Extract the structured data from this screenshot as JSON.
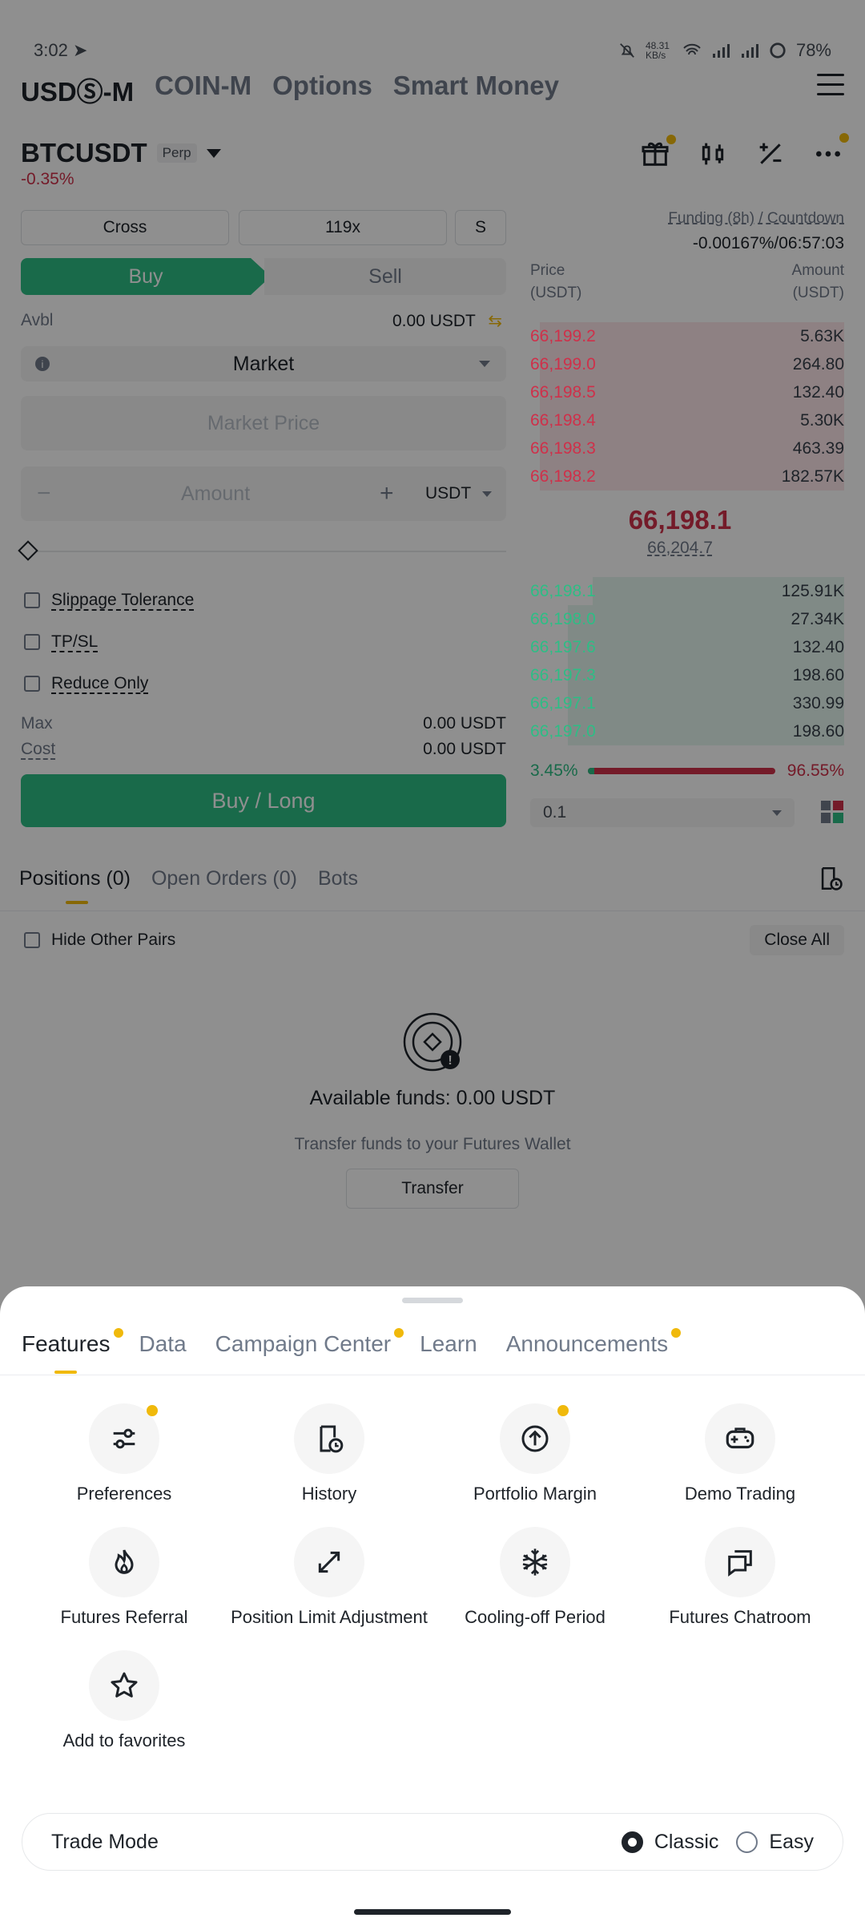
{
  "status_bar": {
    "time": "3:02",
    "net_speed": "48.31 KB/s",
    "battery": "78%"
  },
  "top_tabs": [
    "USDⓈ-M",
    "COIN-M",
    "Options",
    "Smart Money"
  ],
  "pair": {
    "symbol": "BTCUSDT",
    "tag": "Perp",
    "change": "-0.35%"
  },
  "order_form": {
    "margin_mode": "Cross",
    "leverage": "119x",
    "asset_mode": "S",
    "buy_label": "Buy",
    "sell_label": "Sell",
    "avbl_label": "Avbl",
    "avbl_value": "0.00 USDT",
    "order_type": "Market",
    "price_placeholder": "Market Price",
    "amount_placeholder": "Amount",
    "amount_unit": "USDT",
    "checkboxes": [
      "Slippage Tolerance",
      "TP/SL",
      "Reduce Only"
    ],
    "max_label": "Max",
    "max_value": "0.00 USDT",
    "cost_label": "Cost",
    "cost_value": "0.00 USDT",
    "submit_label": "Buy / Long"
  },
  "funding": {
    "label": "Funding (8h) / Countdown",
    "value": "-0.00167%/06:57:03"
  },
  "orderbook": {
    "price_header": "Price",
    "price_unit": "(USDT)",
    "amount_header": "Amount",
    "amount_unit": "(USDT)",
    "asks": [
      {
        "price": "66,199.2",
        "amount": "5.63K",
        "depth": 0.97
      },
      {
        "price": "66,199.0",
        "amount": "264.80",
        "depth": 0.97
      },
      {
        "price": "66,198.5",
        "amount": "132.40",
        "depth": 0.97
      },
      {
        "price": "66,198.4",
        "amount": "5.30K",
        "depth": 0.97
      },
      {
        "price": "66,198.3",
        "amount": "463.39",
        "depth": 0.97
      },
      {
        "price": "66,198.2",
        "amount": "182.57K",
        "depth": 0.97
      }
    ],
    "last_price": "66,198.1",
    "mark_price": "66,204.7",
    "bids": [
      {
        "price": "66,198.1",
        "amount": "125.91K",
        "depth": 0.8
      },
      {
        "price": "66,198.0",
        "amount": "27.34K",
        "depth": 0.88
      },
      {
        "price": "66,197.6",
        "amount": "132.40",
        "depth": 0.88
      },
      {
        "price": "66,197.3",
        "amount": "198.60",
        "depth": 0.88
      },
      {
        "price": "66,197.1",
        "amount": "330.99",
        "depth": 0.88
      },
      {
        "price": "66,197.0",
        "amount": "198.60",
        "depth": 0.88
      }
    ],
    "buy_ratio": "3.45%",
    "sell_ratio": "96.55%",
    "depth_step": "0.1"
  },
  "positions": {
    "tabs": [
      "Positions (0)",
      "Open Orders (0)",
      "Bots"
    ],
    "hide_other_pairs": "Hide Other Pairs",
    "close_all": "Close All",
    "available_funds": "Available funds: 0.00 USDT",
    "transfer_hint": "Transfer funds to your Futures Wallet",
    "transfer_button": "Transfer"
  },
  "sheet": {
    "tabs": [
      {
        "label": "Features",
        "dot": true
      },
      {
        "label": "Data",
        "dot": false
      },
      {
        "label": "Campaign Center",
        "dot": true
      },
      {
        "label": "Learn",
        "dot": false
      },
      {
        "label": "Announcements",
        "dot": true
      }
    ],
    "features": [
      {
        "label": "Preferences",
        "icon": "sliders-icon",
        "dot": true
      },
      {
        "label": "History",
        "icon": "history-icon",
        "dot": false
      },
      {
        "label": "Portfolio Margin",
        "icon": "arrow-up-circle-icon",
        "dot": true
      },
      {
        "label": "Demo Trading",
        "icon": "gamepad-icon",
        "dot": false
      },
      {
        "label": "Futures Referral",
        "icon": "flame-icon",
        "dot": false
      },
      {
        "label": "Position Limit Adjustment",
        "icon": "expand-icon",
        "dot": false
      },
      {
        "label": "Cooling-off Period",
        "icon": "snowflake-icon",
        "dot": false
      },
      {
        "label": "Futures Chatroom",
        "icon": "chat-icon",
        "dot": false
      },
      {
        "label": "Add to favorites",
        "icon": "star-icon",
        "dot": false
      }
    ],
    "trade_mode": {
      "title": "Trade Mode",
      "options": [
        "Classic",
        "Easy"
      ],
      "selected": "Classic"
    }
  },
  "colors": {
    "buy": "#2ebd85",
    "sell": "#cf304a",
    "accent": "#f0b90b"
  }
}
